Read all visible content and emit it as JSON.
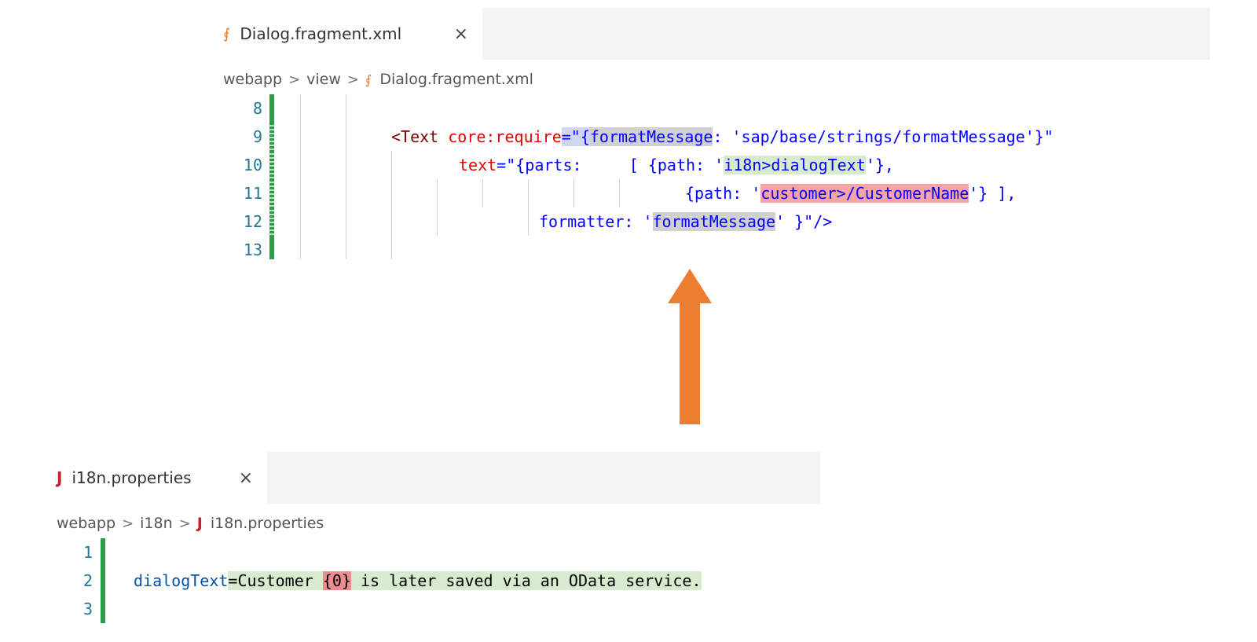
{
  "top_editor": {
    "tab": {
      "label": "Dialog.fragment.xml",
      "icon": "xml-rss-icon",
      "close": "×"
    },
    "breadcrumb": [
      "webapp",
      "view",
      "Dialog.fragment.xml"
    ],
    "lines": [
      {
        "number": "8"
      },
      {
        "number": "9",
        "part1": "<Text",
        "part2": "core:require",
        "part3": "=\"{",
        "part4": "formatMessage",
        "part5": ": 'sap/base/strings/formatMessage'}\""
      },
      {
        "number": "10",
        "part1": "text",
        "part2": "=\"{parts:",
        "part3": "[ {path: '",
        "part4": "i18n>dialogText",
        "part5": "'},"
      },
      {
        "number": "11",
        "part1": "{path: '",
        "part2": "customer>/CustomerName",
        "part3": "'} ],"
      },
      {
        "number": "12",
        "part1": "formatter: '",
        "part2": "formatMessage",
        "part3": "' }\"/>"
      },
      {
        "number": "13"
      }
    ]
  },
  "bottom_editor": {
    "tab": {
      "label": "i18n.properties",
      "icon": "J",
      "close": "×"
    },
    "breadcrumb": [
      "webapp",
      "i18n",
      "i18n.properties"
    ],
    "lines": [
      {
        "number": "1"
      },
      {
        "number": "2",
        "key": "dialogText",
        "eq": "=",
        "val1": "Customer ",
        "placeholder": "{0}",
        "val2": " is later saved via an OData service."
      },
      {
        "number": "3"
      }
    ]
  },
  "colors": {
    "arrow": "#ed7d31",
    "gutter_added": "#2e9a4a",
    "highlight_green": "#d8ebcf",
    "highlight_red": "#f6a4a6",
    "highlight_gray": "#d0d0d0"
  },
  "breadcrumb_separator": ">"
}
